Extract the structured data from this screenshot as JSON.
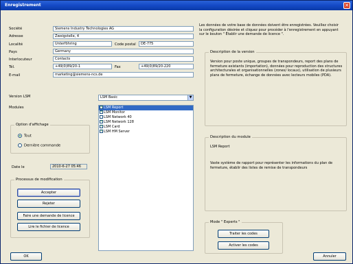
{
  "window": {
    "title": "Enregistrement",
    "close_glyph": "✕"
  },
  "intro_text": "Les données de votre base de données doivent être enregistrées. Veuillez choisir la configuration désirée et cliquez pour procéder à l'enregistrement en appuyant sur le bouton \" Établir une demande de licence \".",
  "company": {
    "societe_label": "Société",
    "societe_value": "Siemens Industry Technologies AG",
    "adresse_label": "Adresse",
    "adresse_value": "Zweigstelle, 4",
    "localite_label": "Localité",
    "localite_value": "Unterföhring",
    "postal_label": "Code postal",
    "postal_value": "DE-775",
    "pays_label": "Pays",
    "pays_value": "Germany",
    "interlocuteur_label": "Interlocuteur",
    "interlocuteur_value": "Contacts",
    "tel_label": "Tél.",
    "tel_value": "+49(0)89/20-1",
    "fax_label": "Fax",
    "fax_value": "+49(0)89/20-220",
    "email_label": "E-mail",
    "email_value": "marketing@siemens-ncs.de"
  },
  "version": {
    "label": "Version LSM",
    "value": "LSM Basic"
  },
  "modules": {
    "label": "Modules",
    "items": [
      {
        "label": "LSM Report",
        "checked": true,
        "selected": true
      },
      {
        "label": "LSM Monitor",
        "checked": true,
        "selected": false
      },
      {
        "label": "LSM Network 40",
        "checked": false,
        "selected": false
      },
      {
        "label": "LSM Network 128",
        "checked": true,
        "selected": false
      },
      {
        "label": "LSM Card",
        "checked": true,
        "selected": false
      },
      {
        "label": "LSM HM Server",
        "checked": true,
        "selected": false
      }
    ]
  },
  "display_options": {
    "title": "Option d'affichage",
    "options": [
      {
        "label": "Tout",
        "selected": true
      },
      {
        "label": "Dernière commande",
        "selected": false
      }
    ]
  },
  "date": {
    "label": "Date le",
    "value": "2010-6-27 05:46"
  },
  "procedure": {
    "title": "Processus de modification",
    "accept": "Accepter",
    "reject": "Rejeter",
    "license_request": "Faire une demande de licence",
    "read_license": "Lire le fichier de licence"
  },
  "version_desc": {
    "title": "Description de la version",
    "text": "Version pour poste unique, groupes de transpondeurs, report des plans de fermeture existants (importation), données pour reproduction des structures architecturales et organisationnelles (zones/ locaux), utilisation de plusieurs plans de fermeture, échange de données avec lecteurs mobiles (PDA)."
  },
  "module_desc": {
    "title": "Description du module",
    "name": "LSM Report",
    "text": "Vaste système de rapport pour représenter les informations du plan de fermeture, établir des listes de remise de transpondeurs"
  },
  "expert": {
    "title": "Mode \" Experts \"",
    "process_codes": "Traiter les codes",
    "activate_codes": "Activer les codes"
  },
  "footer": {
    "ok": "OK",
    "cancel": "Annuler"
  }
}
